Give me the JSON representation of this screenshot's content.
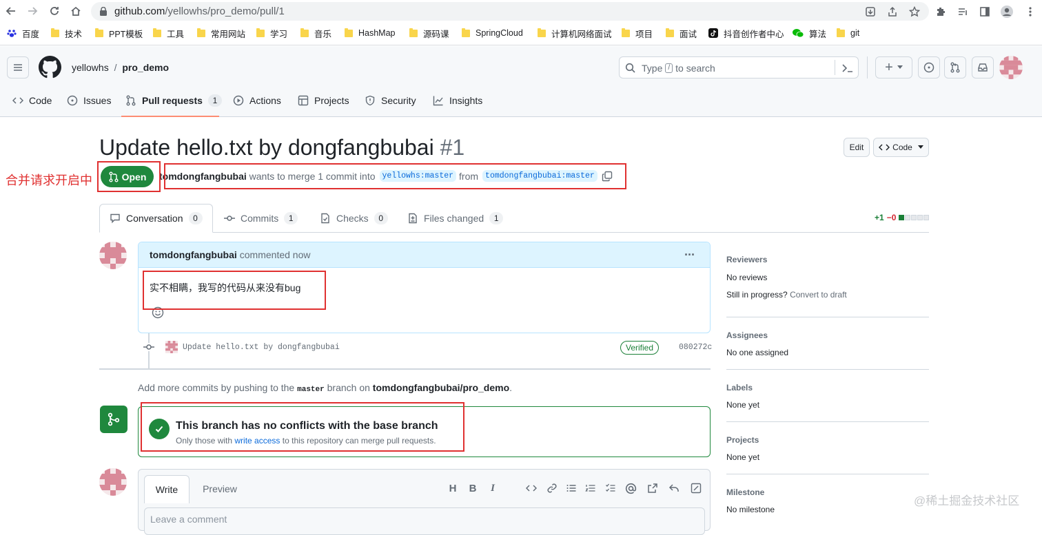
{
  "browser": {
    "url_host": "github.com",
    "url_path": "/yellowhs/pro_demo/pull/1",
    "bookmarks": [
      {
        "label": "百度",
        "icon": "baidu-paw-icon"
      },
      {
        "label": "技术",
        "icon": "folder-icon"
      },
      {
        "label": "PPT模板",
        "icon": "folder-icon"
      },
      {
        "label": "工具",
        "icon": "folder-icon"
      },
      {
        "label": "常用网站",
        "icon": "folder-icon"
      },
      {
        "label": "学习",
        "icon": "folder-icon"
      },
      {
        "label": "音乐",
        "icon": "folder-icon"
      },
      {
        "label": "HashMap",
        "icon": "folder-icon"
      },
      {
        "label": "源码课",
        "icon": "folder-icon"
      },
      {
        "label": "SpringCloud",
        "icon": "folder-icon"
      },
      {
        "label": "计算机网络面试",
        "icon": "folder-icon"
      },
      {
        "label": "项目",
        "icon": "folder-icon"
      },
      {
        "label": "面试",
        "icon": "folder-icon"
      },
      {
        "label": "抖音创作者中心",
        "icon": "douyin-icon"
      },
      {
        "label": "算法",
        "icon": "wechat-icon"
      },
      {
        "label": "git",
        "icon": "folder-icon"
      }
    ]
  },
  "header": {
    "owner": "yellowhs",
    "slash": "/",
    "repo": "pro_demo",
    "search_placeholder_pre": "Type",
    "search_key": "/",
    "search_placeholder_post": "to search",
    "plus": "+"
  },
  "repo_nav": [
    {
      "label": "Code",
      "icon": "code-icon"
    },
    {
      "label": "Issues",
      "icon": "issue-icon"
    },
    {
      "label": "Pull requests",
      "icon": "pull-request-icon",
      "count": "1"
    },
    {
      "label": "Actions",
      "icon": "play-icon"
    },
    {
      "label": "Projects",
      "icon": "table-icon"
    },
    {
      "label": "Security",
      "icon": "shield-icon"
    },
    {
      "label": "Insights",
      "icon": "graph-icon"
    }
  ],
  "pr": {
    "title": "Update hello.txt by dongfangbubai",
    "number": "#1",
    "state": "Open",
    "edit_label": "Edit",
    "code_label": "Code",
    "author": "tomdongfangbubai",
    "meta_text": "wants to merge 1 commit into",
    "base_branch": "yellowhs:master",
    "from_text": "from",
    "head_branch": "tomdongfangbubai:master"
  },
  "annotation": {
    "label": "合并请求开启中"
  },
  "pr_tabs": [
    {
      "label": "Conversation",
      "count": "0",
      "icon": "comment-icon"
    },
    {
      "label": "Commits",
      "count": "1",
      "icon": "commit-icon"
    },
    {
      "label": "Checks",
      "count": "0",
      "icon": "checklist-icon"
    },
    {
      "label": "Files changed",
      "count": "1",
      "icon": "file-diff-icon"
    }
  ],
  "diffstat": {
    "additions": "+1",
    "deletions": "−0"
  },
  "comment": {
    "author": "tomdongfangbubai",
    "time": "commented now",
    "body": "实不相瞒，我写的代码从来没有bug",
    "more": "···"
  },
  "commit": {
    "message": "Update hello.txt by dongfangbubai",
    "badge": "Verified",
    "sha": "080272c"
  },
  "hint": {
    "pre": "Add more commits by pushing to the",
    "branch": "master",
    "mid": "branch on",
    "repo": "tomdongfangbubai/pro_demo",
    "post": "."
  },
  "merge": {
    "title": "This branch has no conflicts with the base branch",
    "sub_pre": "Only those with",
    "sub_link": "write access",
    "sub_post": "to this repository can merge pull requests."
  },
  "editor": {
    "write_tab": "Write",
    "preview_tab": "Preview",
    "placeholder": "Leave a comment",
    "tools": [
      "H",
      "B",
      "I"
    ]
  },
  "sidebar": {
    "reviewers_label": "Reviewers",
    "reviewers_value": "No reviews",
    "draft_pre": "Still in progress?",
    "draft_link": "Convert to draft",
    "assignees_label": "Assignees",
    "assignees_value": "No one assigned",
    "labels_label": "Labels",
    "labels_value": "None yet",
    "projects_label": "Projects",
    "projects_value": "None yet",
    "milestone_label": "Milestone",
    "milestone_value": "No milestone"
  },
  "watermark": "@稀土掘金技术社区",
  "colors": {
    "open": "#1f883d",
    "link": "#0969da",
    "annotation": "#e03030",
    "tab_underline": "#fd8c73"
  }
}
